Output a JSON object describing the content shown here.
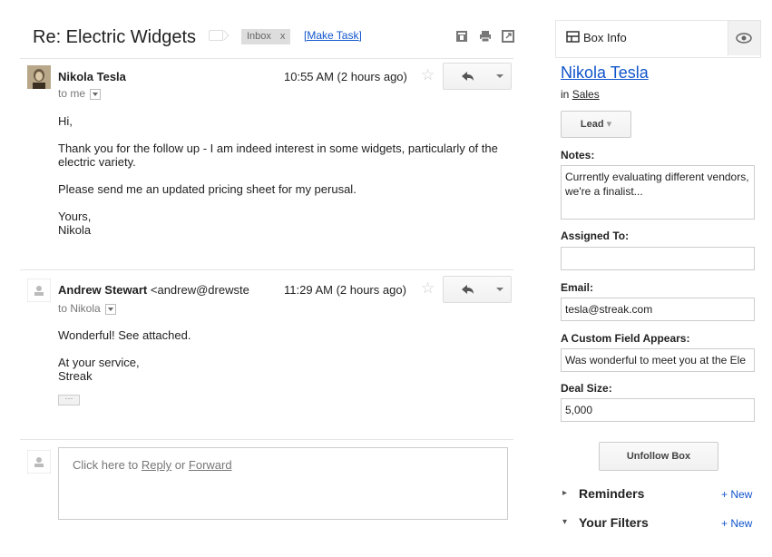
{
  "thread": {
    "subject": "Re: Electric Widgets",
    "label": "Inbox",
    "label_remove": "x",
    "make_task": "[Make Task]"
  },
  "messages": [
    {
      "sender": "Nikola Tesla",
      "sender_email": "",
      "to": "to me",
      "time": "10:55 AM (2 hours ago)",
      "body": [
        "Hi,",
        "Thank you for the follow up - I am indeed interest in some widgets, particularly of the electric variety.",
        "Please send me an updated pricing sheet for my perusal.",
        "Yours,",
        "Nikola"
      ]
    },
    {
      "sender": "Andrew Stewart",
      "sender_email": "<andrew@drewste",
      "to": "to Nikola",
      "time": "11:29 AM (2 hours ago)",
      "body": [
        "Wonderful! See attached.",
        "At your service,",
        "Streak"
      ],
      "trimmed": "···"
    }
  ],
  "reply": {
    "prefix": "Click here to ",
    "reply_link": "Reply",
    "or": " or ",
    "forward_link": "Forward"
  },
  "sidebar": {
    "title": "Box Info",
    "contact_name": "Nikola Tesla",
    "in_prefix": "in ",
    "pipeline": "Sales",
    "stage": "Lead",
    "notes_label": "Notes:",
    "notes_value": "Currently evaluating different vendors, we're a finalist...",
    "assigned_label": "Assigned To:",
    "assigned_value": "",
    "email_label": "Email:",
    "email_value": "tesla@streak.com",
    "custom_label": "A Custom Field Appears:",
    "custom_value": "Was wonderful to meet you at the Ele",
    "deal_label": "Deal Size:",
    "deal_value": "5,000",
    "unfollow": "Unfollow Box",
    "reminders": "Reminders",
    "reminders_new": "+ New",
    "filters": "Your Filters",
    "filters_new": "+ New"
  },
  "icons": [
    "label-icon",
    "archive-icon",
    "print-icon",
    "new-window-icon",
    "star-icon",
    "reply-icon",
    "dropdown-icon",
    "box-icon",
    "eye-icon",
    "person-icon"
  ],
  "colors": {
    "link": "#1155cc",
    "border": "#e5e5e5"
  }
}
